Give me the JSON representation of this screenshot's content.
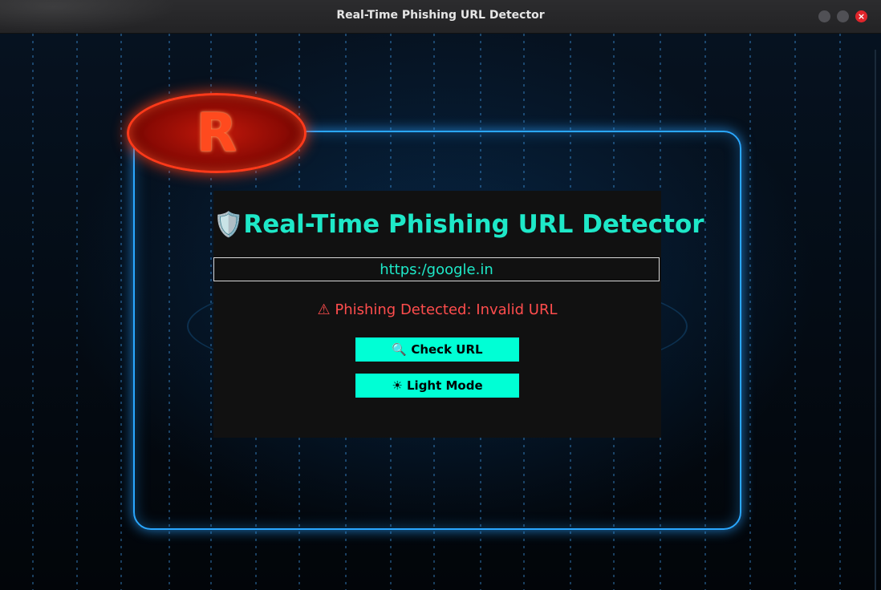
{
  "window": {
    "title": "Real-Time Phishing URL Detector",
    "close_glyph": "×"
  },
  "logo": {
    "letter": "R"
  },
  "app": {
    "shield_icon": "🛡️",
    "title": "Real-Time Phishing URL Detector",
    "url_value": "https:/google.in",
    "result_text": "⚠ Phishing Detected: Invalid URL",
    "check_button": "🔍 Check URL",
    "theme_button": "☀ Light Mode"
  },
  "colors": {
    "accent": "#00ffd5",
    "title_text": "#1ee8c8",
    "error": "#ff4d4d",
    "panel_bg": "#111111",
    "frame_glow": "#2aa7ff",
    "logo_red": "#ff3a1a"
  }
}
